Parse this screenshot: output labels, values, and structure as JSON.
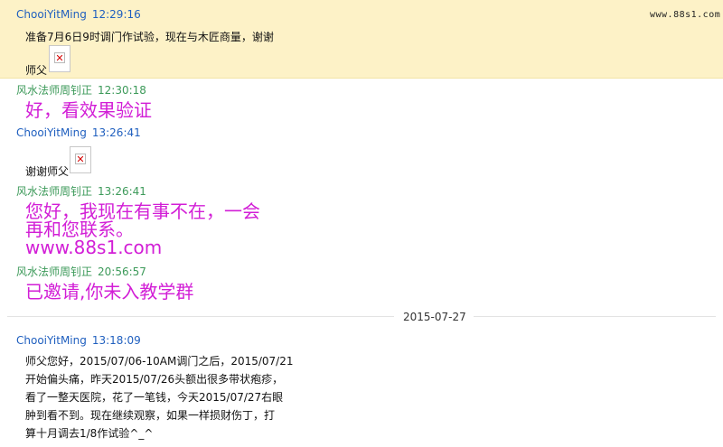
{
  "watermark": "www.88s1.com",
  "messages": [
    {
      "sender": "ChooiYitMing",
      "time": "12:29:16",
      "line1": "准备7月6日9时调门作试验，现在与木匠商量，谢谢",
      "line2": "师父"
    },
    {
      "sender": "风水法师周钊正",
      "time": "12:30:18",
      "text": "好，看效果验证"
    },
    {
      "sender": "ChooiYitMing",
      "time": "13:26:41",
      "text": "谢谢师父"
    },
    {
      "sender": "风水法师周钊正",
      "time": "13:26:41",
      "line1": "您好，我现在有事不在，一会",
      "line2": "再和您联系。",
      "line3": "www.88s1.com"
    },
    {
      "sender": "风水法师周钊正",
      "time": "20:56:57",
      "text": "已邀请,你未入教学群"
    },
    {
      "sender": "ChooiYitMing",
      "time": "13:18:09",
      "lines": [
        "师父您好，2015/07/06-10AM调门之后，2015/07/21",
        "开始偏头痛，昨天2015/07/26头额出很多带状疱疹，",
        "看了一整天医院，花了一笔钱，今天2015/07/27右眼",
        "肿到看不到。现在继续观察，如果一样损财伤丁，打",
        "算十月调去1/8作试验^_^"
      ]
    }
  ],
  "date_separator": "2015-07-27",
  "broken_image_glyph": "✕",
  "colors": {
    "highlight_bg": "#fdf2c7",
    "sender_blue": "#1f5fbf",
    "sender_green": "#3d9a5a",
    "emphasis_magenta": "#d21ed6"
  }
}
